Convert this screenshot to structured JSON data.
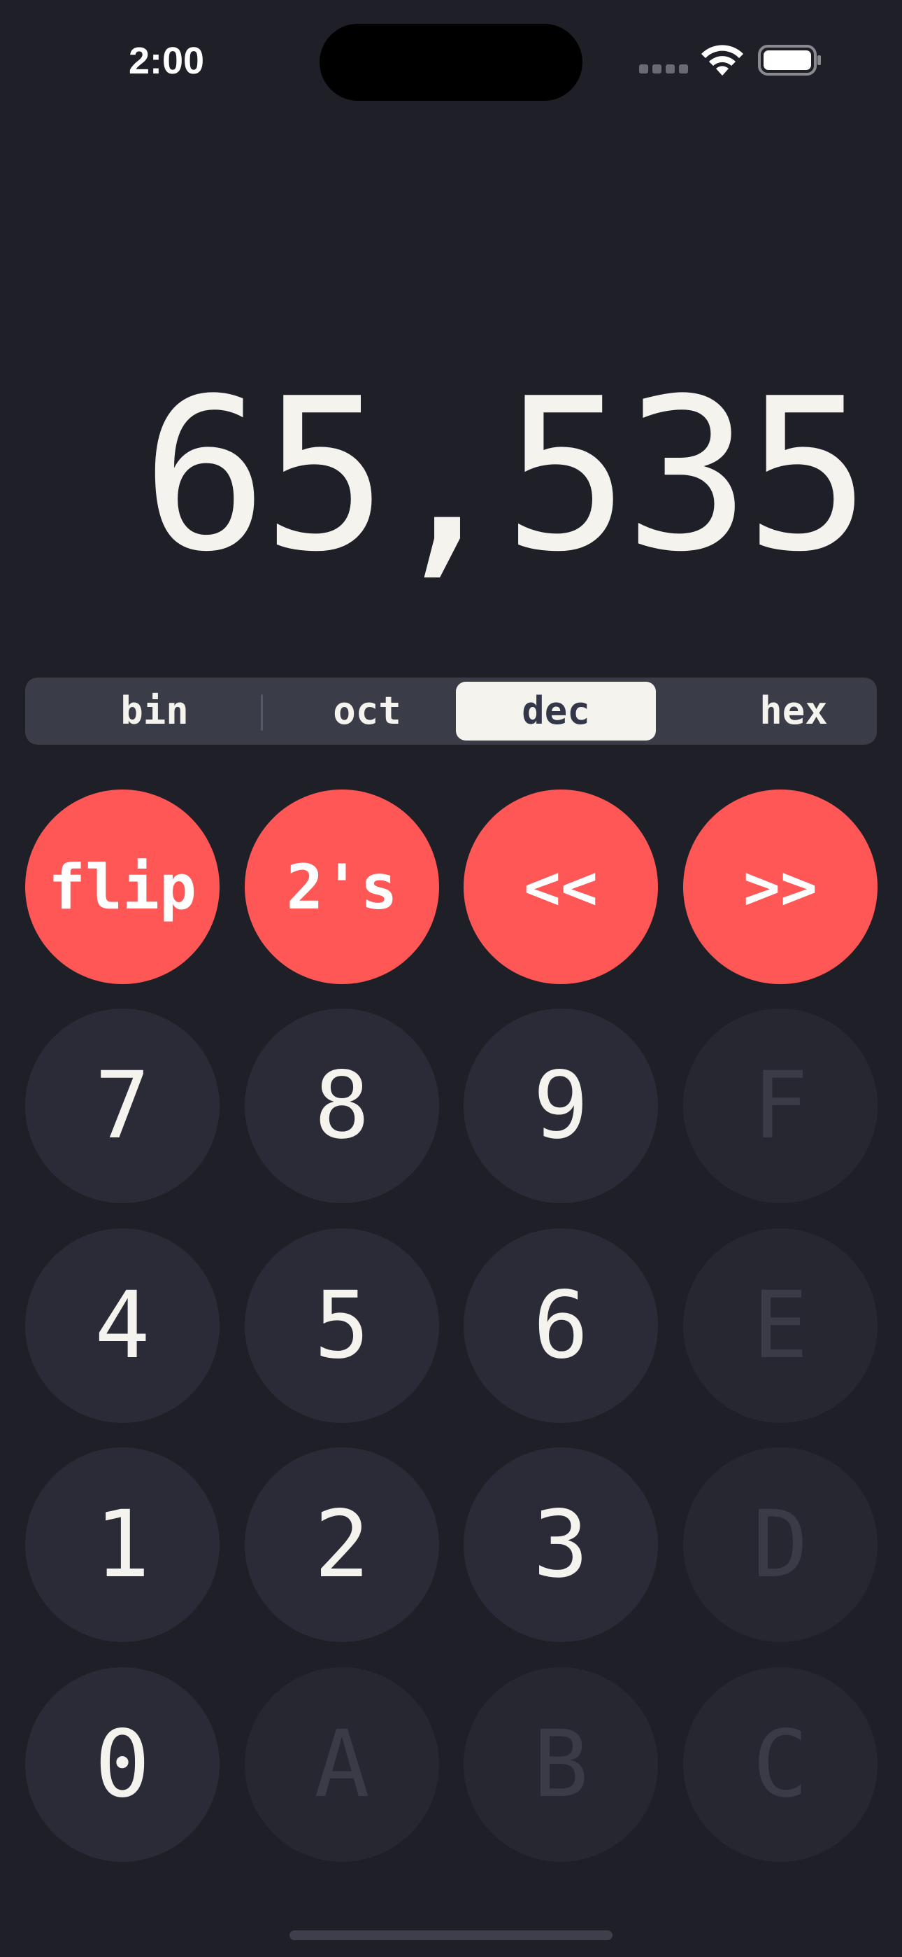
{
  "status_bar": {
    "time": "2:00"
  },
  "display": {
    "value": "65,535"
  },
  "base_selector": {
    "tabs": [
      "bin",
      "oct",
      "dec",
      "hex"
    ],
    "selected": "dec"
  },
  "keypad": {
    "operations": [
      "flip",
      "2's",
      "<<",
      ">>"
    ],
    "rows": [
      [
        "7",
        "8",
        "9",
        "F"
      ],
      [
        "4",
        "5",
        "6",
        "E"
      ],
      [
        "1",
        "2",
        "3",
        "D"
      ],
      [
        "0",
        "A",
        "B",
        "C"
      ]
    ],
    "disabled_keys": [
      "F",
      "E",
      "D",
      "A",
      "B",
      "C"
    ]
  },
  "colors": {
    "background": "#1f1f28",
    "operation_key": "#ff5656",
    "digit_key": "#2a2b36",
    "disabled_key": "#262731",
    "selector_background": "#3a3c48",
    "selector_active": "#f5f3ee"
  },
  "icons": [
    "signal-icon",
    "wifi-icon",
    "battery-icon"
  ]
}
